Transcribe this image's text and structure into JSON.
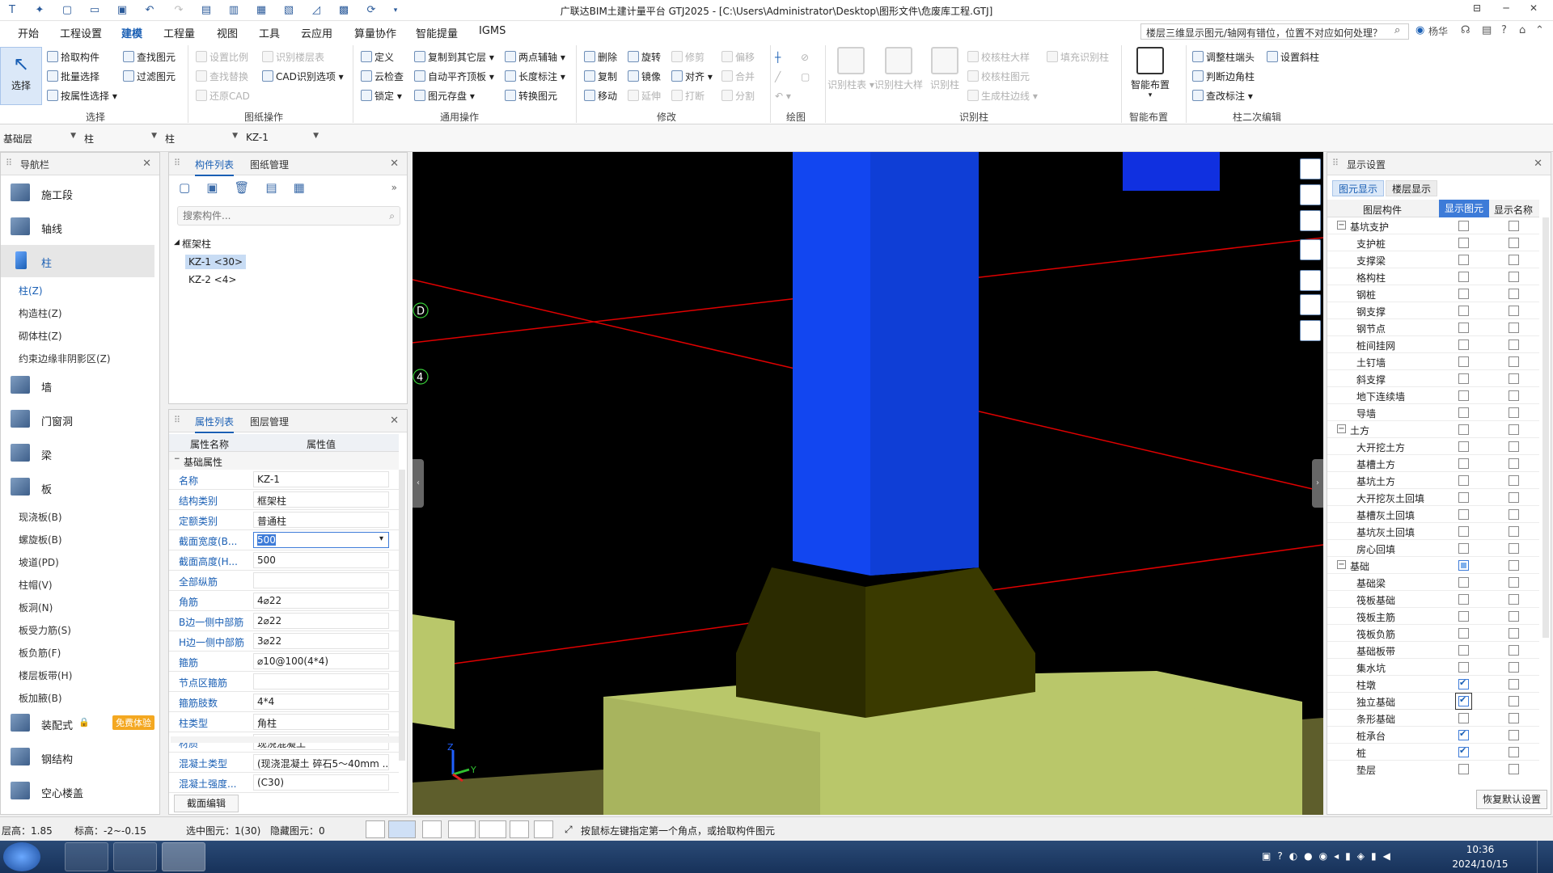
{
  "title": "广联达BIM土建计量平台 GTJ2025 - [C:\\Users\\Administrator\\Desktop\\图形文件\\危废库工程.GTJ]",
  "menu": [
    "开始",
    "工程设置",
    "建模",
    "工程量",
    "视图",
    "工具",
    "云应用",
    "算量协作",
    "智能提量",
    "IGMS"
  ],
  "menu_active": "建模",
  "help_search": "楼层三维显示图元/轴网有错位，位置不对应如何处理？",
  "user": "杨华",
  "ribbon": {
    "select": {
      "label": "选择",
      "big": "选择",
      "items": [
        "拾取构件",
        "批量选择",
        "按属性选择",
        "查找图元",
        "过滤图元"
      ]
    },
    "drawing": {
      "label": "图纸操作",
      "items": [
        "设置比例",
        "查找替换",
        "还原CAD",
        "识别楼层表",
        "CAD识别选项"
      ]
    },
    "common": {
      "label": "通用操作",
      "items": [
        "定义",
        "云检查",
        "锁定",
        "复制到其它层",
        "自动平齐顶板",
        "图元存盘",
        "两点辅轴",
        "长度标注",
        "转换图元"
      ]
    },
    "modify": {
      "label": "修改",
      "items": [
        "删除",
        "复制",
        "移动",
        "旋转",
        "镜像",
        "延伸",
        "修剪",
        "对齐",
        "打断",
        "偏移",
        "合并",
        "分割"
      ]
    },
    "draw": {
      "label": "绘图"
    },
    "recognize": {
      "label": "识别柱",
      "big": [
        "识别柱表",
        "识别柱大样",
        "识别柱"
      ],
      "items": [
        "校核柱大样",
        "校核柱图元",
        "生成柱边线",
        "填充识别柱"
      ]
    },
    "smart": {
      "label": "智能布置",
      "big": "智能布置"
    },
    "edit2": {
      "label": "柱二次编辑",
      "items": [
        "调整柱端头",
        "判断边角柱",
        "查改标注",
        "设置斜柱"
      ]
    }
  },
  "selectors": [
    "基础层",
    "柱",
    "柱",
    "KZ-1"
  ],
  "nav": {
    "title": "导航栏",
    "categories": [
      {
        "label": "施工段"
      },
      {
        "label": "轴线"
      },
      {
        "label": "柱"
      },
      {
        "label": "墙"
      },
      {
        "label": "门窗洞"
      },
      {
        "label": "梁"
      },
      {
        "label": "板"
      },
      {
        "label": "装配式"
      },
      {
        "label": "钢结构"
      },
      {
        "label": "空心楼盖"
      }
    ],
    "col_subs": [
      "柱(Z)",
      "构造柱(Z)",
      "砌体柱(Z)",
      "约束边缘非阴影区(Z)"
    ],
    "slab_subs": [
      "现浇板(B)",
      "螺旋板(B)",
      "坡道(PD)",
      "柱帽(V)",
      "板洞(N)",
      "板受力筋(S)",
      "板负筋(F)",
      "楼层板带(H)",
      "板加腋(B)"
    ],
    "trial": "免费体验"
  },
  "component_panel": {
    "tabs": [
      "构件列表",
      "图纸管理"
    ],
    "search_placeholder": "搜索构件...",
    "group": "框架柱",
    "items": [
      "KZ-1 <30>",
      "KZ-2 <4>"
    ]
  },
  "property_panel": {
    "tabs": [
      "属性列表",
      "图层管理"
    ],
    "col_name": "属性名称",
    "col_value": "属性值",
    "section": "基础属性",
    "rows": [
      {
        "name": "名称",
        "value": "KZ-1"
      },
      {
        "name": "结构类别",
        "value": "框架柱"
      },
      {
        "name": "定额类别",
        "value": "普通柱"
      },
      {
        "name": "截面宽度(B...",
        "value": "500"
      },
      {
        "name": "截面高度(H...",
        "value": "500"
      },
      {
        "name": "全部纵筋",
        "value": ""
      },
      {
        "name": "角筋",
        "value": "4⌀22"
      },
      {
        "name": "B边一侧中部筋",
        "value": "2⌀22"
      },
      {
        "name": "H边一侧中部筋",
        "value": "3⌀22"
      },
      {
        "name": "箍筋",
        "value": "⌀10@100(4*4)"
      },
      {
        "name": "节点区箍筋",
        "value": ""
      },
      {
        "name": "箍筋肢数",
        "value": "4*4"
      },
      {
        "name": "柱类型",
        "value": "角柱"
      },
      {
        "name": "材质",
        "value": "现浇混凝土"
      },
      {
        "name": "混凝土类型",
        "value": "(现浇混凝土   碎石5～40mm ..."
      },
      {
        "name": "混凝土强度...",
        "value": "(C30)"
      }
    ],
    "bottom_button": "截面编辑"
  },
  "viewport": {
    "axis_labels": [
      "D",
      "4"
    ],
    "triad": {
      "z": "Z",
      "y": "Y"
    }
  },
  "display_panel": {
    "title": "显示设置",
    "tabs": [
      "图元显示",
      "楼层显示"
    ],
    "cols": [
      "图层构件",
      "显示图元",
      "显示名称"
    ],
    "rows": [
      {
        "name": "基坑支护",
        "level": 0,
        "toggle": "−",
        "show": false,
        "label": false
      },
      {
        "name": "支护桩",
        "level": 1,
        "show": false,
        "label": false
      },
      {
        "name": "支撑梁",
        "level": 1,
        "show": false,
        "label": false
      },
      {
        "name": "格构柱",
        "level": 1,
        "show": false,
        "label": false
      },
      {
        "name": "钢桩",
        "level": 1,
        "show": false,
        "label": false
      },
      {
        "name": "钢支撑",
        "level": 1,
        "show": false,
        "label": false
      },
      {
        "name": "钢节点",
        "level": 1,
        "show": false,
        "label": false
      },
      {
        "name": "桩间挂网",
        "level": 1,
        "show": false,
        "label": false
      },
      {
        "name": "土钉墙",
        "level": 1,
        "show": false,
        "label": false
      },
      {
        "name": "斜支撑",
        "level": 1,
        "show": false,
        "label": false
      },
      {
        "name": "地下连续墙",
        "level": 1,
        "show": false,
        "label": false
      },
      {
        "name": "导墙",
        "level": 1,
        "show": false,
        "label": false
      },
      {
        "name": "土方",
        "level": 0,
        "toggle": "−",
        "show": false,
        "label": false
      },
      {
        "name": "大开挖土方",
        "level": 1,
        "show": false,
        "label": false
      },
      {
        "name": "基槽土方",
        "level": 1,
        "show": false,
        "label": false
      },
      {
        "name": "基坑土方",
        "level": 1,
        "show": false,
        "label": false
      },
      {
        "name": "大开挖灰土回填",
        "level": 1,
        "show": false,
        "label": false
      },
      {
        "name": "基槽灰土回填",
        "level": 1,
        "show": false,
        "label": false
      },
      {
        "name": "基坑灰土回填",
        "level": 1,
        "show": false,
        "label": false
      },
      {
        "name": "房心回填",
        "level": 1,
        "show": false,
        "label": false
      },
      {
        "name": "基础",
        "level": 0,
        "toggle": "−",
        "show": "partial",
        "label": false
      },
      {
        "name": "基础梁",
        "level": 1,
        "show": false,
        "label": false
      },
      {
        "name": "筏板基础",
        "level": 1,
        "show": false,
        "label": false
      },
      {
        "name": "筏板主筋",
        "level": 1,
        "show": false,
        "label": false
      },
      {
        "name": "筏板负筋",
        "level": 1,
        "show": false,
        "label": false
      },
      {
        "name": "基础板带",
        "level": 1,
        "show": false,
        "label": false
      },
      {
        "name": "集水坑",
        "level": 1,
        "show": false,
        "label": false
      },
      {
        "name": "柱墩",
        "level": 1,
        "show": true,
        "label": false
      },
      {
        "name": "独立基础",
        "level": 1,
        "show": true,
        "label": false
      },
      {
        "name": "条形基础",
        "level": 1,
        "show": false,
        "label": false
      },
      {
        "name": "桩承台",
        "level": 1,
        "show": true,
        "label": false
      },
      {
        "name": "桩",
        "level": 1,
        "show": true,
        "label": false
      },
      {
        "name": "垫层",
        "level": 1,
        "show": false,
        "label": false
      }
    ],
    "restore_button": "恢复默认设置"
  },
  "status": {
    "floor_height": "层高：1.85",
    "elevation": "标高：-2~-0.15",
    "selected": "选中图元：1(30)",
    "hidden": "隐藏图元：0",
    "hint": "按鼠标左键指定第一个角点，或拾取构件图元"
  },
  "clock": {
    "time": "10:36",
    "date": "2024/10/15"
  },
  "colors": {
    "accent": "#1a5fb4",
    "column": "#1246f0",
    "pier": "#3a3a00",
    "footing": "#b9c76a"
  }
}
